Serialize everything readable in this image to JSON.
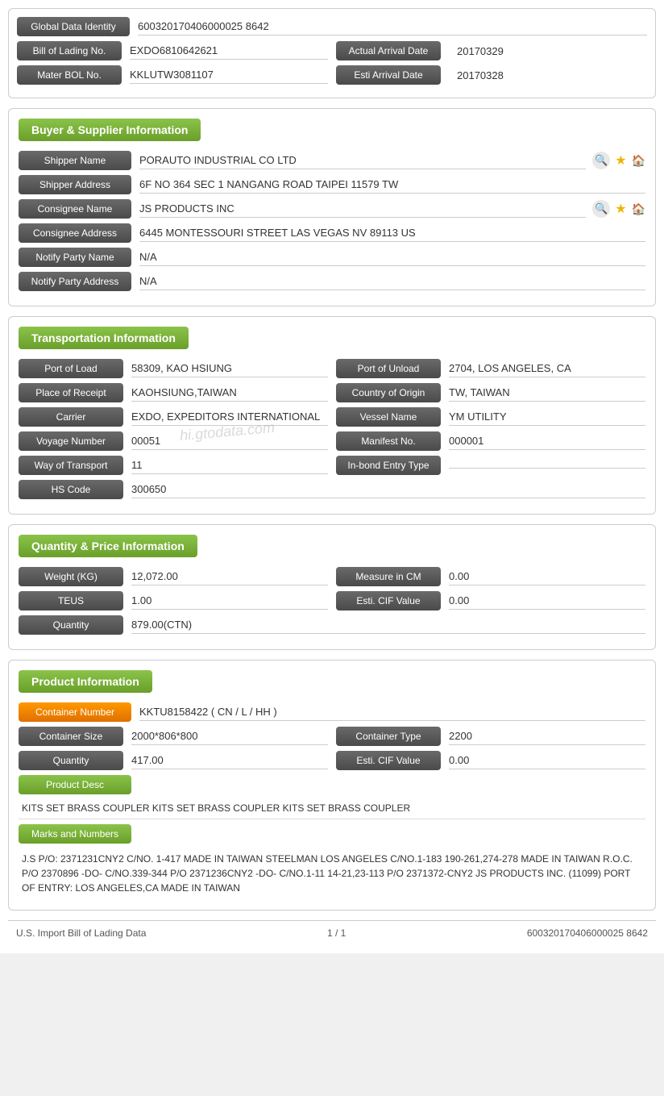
{
  "header": {
    "global_label": "Global Data Identity",
    "global_value": "600320170406000025 8642",
    "bol_label": "Bill of Lading No.",
    "bol_value": "EXDO6810642621",
    "actual_arrival_label": "Actual Arrival Date",
    "actual_arrival_value": "20170329",
    "mater_bol_label": "Mater BOL No.",
    "mater_bol_value": "KKLUTW3081107",
    "esti_arrival_label": "Esti Arrival Date",
    "esti_arrival_value": "20170328"
  },
  "buyer_supplier": {
    "section_title": "Buyer & Supplier Information",
    "shipper_name_label": "Shipper Name",
    "shipper_name_value": "PORAUTO INDUSTRIAL CO LTD",
    "shipper_address_label": "Shipper Address",
    "shipper_address_value": "6F NO 364 SEC 1 NANGANG ROAD TAIPEI 11579 TW",
    "consignee_name_label": "Consignee Name",
    "consignee_name_value": "JS PRODUCTS INC",
    "consignee_address_label": "Consignee Address",
    "consignee_address_value": "6445 MONTESSOURI STREET LAS VEGAS NV 89113 US",
    "notify_party_name_label": "Notify Party Name",
    "notify_party_name_value": "N/A",
    "notify_party_address_label": "Notify Party Address",
    "notify_party_address_value": "N/A"
  },
  "transportation": {
    "section_title": "Transportation Information",
    "port_load_label": "Port of Load",
    "port_load_value": "58309, KAO HSIUNG",
    "port_unload_label": "Port of Unload",
    "port_unload_value": "2704, LOS ANGELES, CA",
    "place_receipt_label": "Place of Receipt",
    "place_receipt_value": "KAOHSIUNG,TAIWAN",
    "country_origin_label": "Country of Origin",
    "country_origin_value": "TW, TAIWAN",
    "carrier_label": "Carrier",
    "carrier_value": "EXDO, EXPEDITORS INTERNATIONAL",
    "vessel_name_label": "Vessel Name",
    "vessel_name_value": "YM UTILITY",
    "voyage_label": "Voyage Number",
    "voyage_value": "00051",
    "manifest_label": "Manifest No.",
    "manifest_value": "000001",
    "way_transport_label": "Way of Transport",
    "way_transport_value": "11",
    "inbond_label": "In-bond Entry Type",
    "inbond_value": "",
    "hs_code_label": "HS Code",
    "hs_code_value": "300650"
  },
  "quantity_price": {
    "section_title": "Quantity & Price Information",
    "weight_label": "Weight (KG)",
    "weight_value": "12,072.00",
    "measure_label": "Measure in CM",
    "measure_value": "0.00",
    "teus_label": "TEUS",
    "teus_value": "1.00",
    "esti_cif_label": "Esti. CIF Value",
    "esti_cif_value": "0.00",
    "quantity_label": "Quantity",
    "quantity_value": "879.00(CTN)"
  },
  "product": {
    "section_title": "Product Information",
    "container_number_label": "Container Number",
    "container_number_value": "KKTU8158422 ( CN / L / HH )",
    "container_size_label": "Container Size",
    "container_size_value": "2000*806*800",
    "container_type_label": "Container Type",
    "container_type_value": "2200",
    "quantity_label": "Quantity",
    "quantity_value": "417.00",
    "esti_cif_label": "Esti. CIF Value",
    "esti_cif_value": "0.00",
    "product_desc_label": "Product Desc",
    "product_desc_text": "KITS SET BRASS COUPLER KITS SET BRASS COUPLER KITS SET BRASS COUPLER",
    "marks_label": "Marks and Numbers",
    "marks_text": "J.S P/O: 2371231CNY2 C/NO. 1-417 MADE IN TAIWAN STEELMAN LOS ANGELES C/NO.1-183 190-261,274-278 MADE IN TAIWAN R.O.C. P/O 2370896 -DO- C/NO.339-344 P/O 2371236CNY2 -DO- C/NO.1-11 14-21,23-113 P/O 2371372-CNY2 JS PRODUCTS INC. (11099) PORT OF ENTRY: LOS ANGELES,CA MADE IN TAIWAN"
  },
  "footer": {
    "left": "U.S. Import Bill of Lading Data",
    "center": "1 / 1",
    "right": "600320170406000025 8642"
  },
  "watermark": "hi.gtodata.com"
}
